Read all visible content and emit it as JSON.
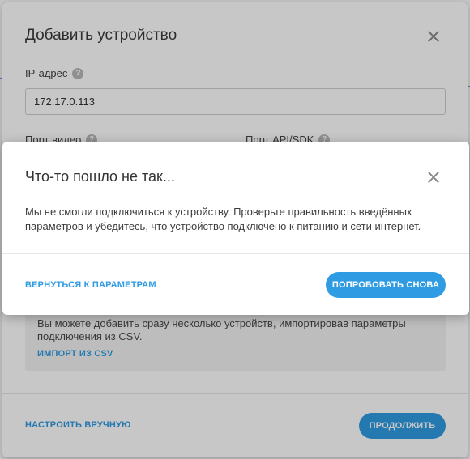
{
  "back_modal": {
    "title": "Добавить устройство",
    "ip_label": "IP-адрес",
    "ip_value": "172.17.0.113",
    "port_video_label": "Порт видео",
    "port_api_label": "Порт API/SDK",
    "csv_text": "Вы можете добавить сразу несколько устройств, импортировав параметры подключения из CSV.",
    "csv_link": "ИМПОРТ ИЗ CSV",
    "manual_link": "НАСТРОИТЬ ВРУЧНУЮ",
    "continue_button": "ПРОДОЛЖИТЬ",
    "help_glyph": "?"
  },
  "error_dialog": {
    "title": "Что-то пошло не так...",
    "message": "Мы не смогли подключиться к устройству. Проверьте правильность введённых параметров и убедитесь, что устройство подключено к питанию и сети интернет.",
    "back_link": "ВЕРНУТЬСЯ К ПАРАМЕТРАМ",
    "retry_button": "ПОПРОБОВАТЬ СНОВА"
  },
  "colors": {
    "accent": "#2f9be3",
    "overlay": "rgba(0,0,0,0.22)"
  },
  "icons": [
    "close-icon",
    "help-icon"
  ]
}
